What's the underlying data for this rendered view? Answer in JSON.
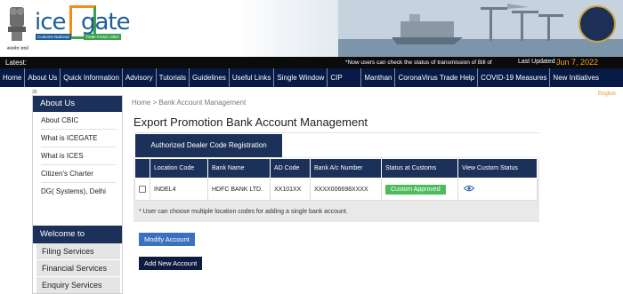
{
  "header": {
    "emblem_caption": "सत्यमेव जयते",
    "logo_ice": "ice",
    "logo_gate": "gate",
    "logo_tag_left": "Customs National",
    "logo_tag_right": "Trade Portal, CBIC"
  },
  "latest_bar": {
    "label": "Latest:",
    "ticker": "*Now users can check the status of transmission of Bill of",
    "updated_label": "Last Updated :",
    "updated_date": "Jun 7, 2022"
  },
  "nav": {
    "items": [
      "Home",
      "About Us",
      "Quick Information",
      "Advisory",
      "Tutorials",
      "Guidelines",
      "Useful Links",
      "Single Window",
      "CIP",
      "Manthan",
      "CoronaVirus Trade Help",
      "COVID-19 Measures",
      "New Initiatives"
    ]
  },
  "sidebar": {
    "tiny_mark": "35",
    "title": "About Us",
    "links": [
      "About CBIC",
      "What is ICEGATE",
      "What is ICES",
      "Citizen's Charter",
      "DG( Systems), Delhi"
    ],
    "welcome": "Welcome to ICEGATE",
    "services": [
      "Filing Services",
      "Financial Services",
      "Enquiry Services"
    ]
  },
  "right_mark": "English",
  "main": {
    "breadcrumb": "Home > Bank Account Management",
    "title": "Export Promotion Bank Account Management",
    "tab": "Authorized Dealer Code Registration",
    "columns": [
      "",
      "Location Code",
      "Bank Name",
      "AD Code",
      "Bank A/c Number",
      "Status at Customs",
      "View Custom Status"
    ],
    "rows": [
      {
        "location_code": "INDEL4",
        "bank_name": "HDFC BANK LTD.",
        "ad_code": "XX101XX",
        "account_number": "XXXX006698XXXX",
        "status": "Custom Approved"
      }
    ],
    "note": "* User can choose multiple location codes for adding a single bank account.",
    "modify_button": "Modify Account",
    "add_button": "Add New Account"
  },
  "colors": {
    "navy": "#1c3159",
    "nav_bg": "#071a45",
    "approved_green": "#4cbb5b",
    "accent_orange": "#f7a21b",
    "modify_blue": "#3b6fbf"
  }
}
